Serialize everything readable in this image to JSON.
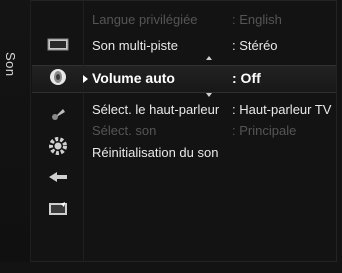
{
  "side_title": "Son",
  "menu_items": [
    {
      "label": "Langue privilégiée",
      "value": ": English",
      "state": "disabled"
    },
    {
      "label": "Son multi-piste",
      "value": ": Stéréo",
      "state": "normal"
    },
    {
      "label": "Volume auto",
      "value": ": Off",
      "state": "selected"
    },
    {
      "label": "Sélect. le haut-parleur",
      "value": ": Haut-parleur TV",
      "state": "normal"
    },
    {
      "label": "Sélect. son",
      "value": ": Principale",
      "state": "disabled"
    },
    {
      "label": "Réinitialisation du son",
      "value": "",
      "state": "normal"
    }
  ],
  "icons": [
    "picture-icon",
    "sound-icon",
    "channel-icon",
    "setup-icon",
    "input-icon",
    "application-icon"
  ]
}
